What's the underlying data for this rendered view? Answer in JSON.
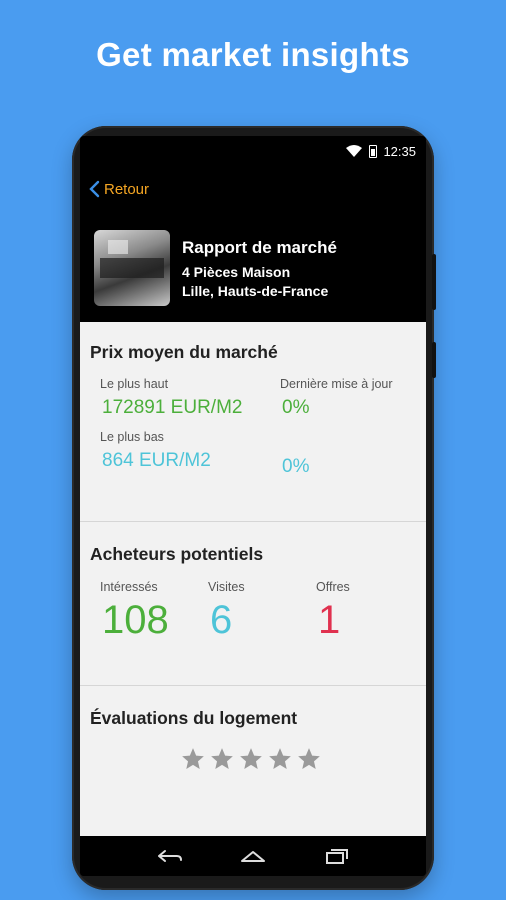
{
  "headline": "Get market insights",
  "status": {
    "time": "12:35"
  },
  "nav": {
    "back_label": "Retour"
  },
  "report": {
    "title": "Rapport de marché",
    "property": "4 Pièces Maison",
    "location": "Lille, Hauts-de-France"
  },
  "market_price": {
    "title": "Prix moyen du marché",
    "highest_label": "Le plus haut",
    "highest_value": "172891 EUR/M2",
    "last_update_label": "Dernière mise à jour",
    "highest_change": "0%",
    "lowest_label": "Le plus bas",
    "lowest_value": "864 EUR/M2",
    "lowest_change": "0%"
  },
  "buyers": {
    "title": "Acheteurs potentiels",
    "interested_label": "Intéressés",
    "interested_value": "108",
    "visits_label": "Visites",
    "visits_value": "6",
    "offers_label": "Offres",
    "offers_value": "1"
  },
  "ratings": {
    "title": "Évaluations du logement",
    "stars_filled": 0,
    "stars_total": 5
  },
  "colors": {
    "background": "#4a9cf0",
    "accent_back": "#f5a623",
    "green": "#4caf3b",
    "cyan": "#4ec4d8",
    "red": "#e0314f",
    "star_empty": "#9a9a9a"
  },
  "icons": {
    "back": "chevron-left-icon",
    "wifi": "wifi-icon",
    "battery": "battery-icon",
    "star": "star-icon",
    "nav_back": "nav-back-icon",
    "nav_home": "nav-home-icon",
    "nav_recents": "nav-recents-icon"
  }
}
